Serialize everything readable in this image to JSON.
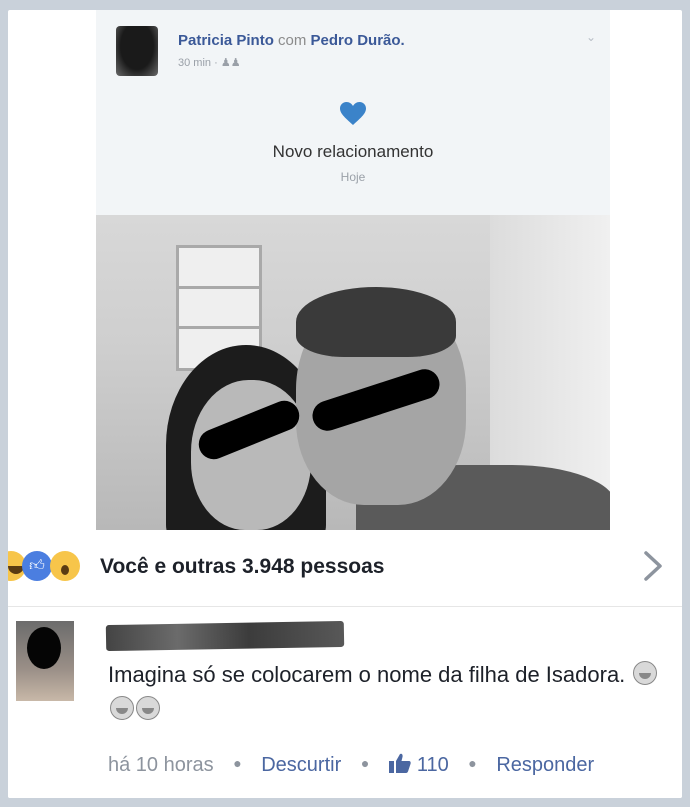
{
  "post": {
    "author": "Patricia Pinto",
    "with_label": "com",
    "tagged": "Pedro Durão.",
    "time": "30 min",
    "event_title": "Novo relacionamento",
    "event_date": "Hoje"
  },
  "reactions": {
    "summary": "Você e outras 3.948 pessoas",
    "icons": [
      "haha-icon",
      "like-icon",
      "wow-icon"
    ]
  },
  "comment": {
    "text": "Imagina só se colocarem o nome da filha de Isadora.",
    "time": "há 10 horas",
    "action_unlike": "Descurtir",
    "likes": "110",
    "action_reply": "Responder"
  },
  "colors": {
    "brand_link": "#3b5998",
    "heart": "#3b83c9",
    "text_primary": "#1d2129",
    "text_muted": "#8d949e"
  }
}
